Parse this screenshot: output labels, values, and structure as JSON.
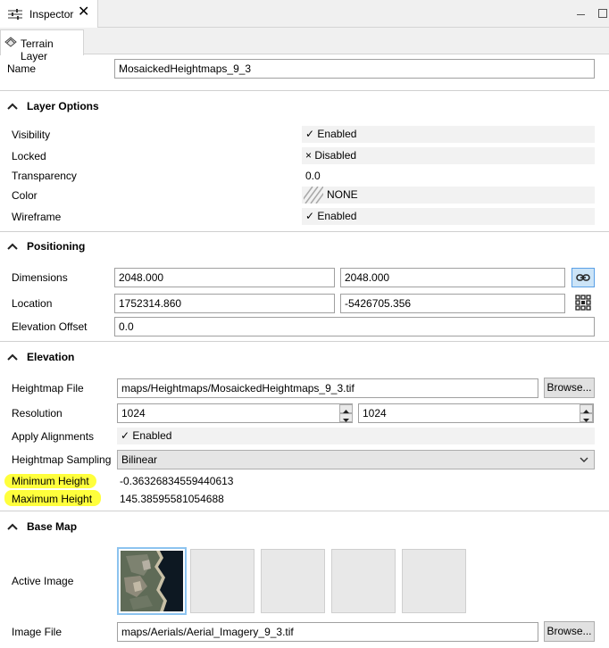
{
  "window": {
    "tab_title": "Inspector",
    "sub_tab": "Terrain Layer"
  },
  "name": {
    "label": "Name",
    "value": "MosaickedHeightmaps_9_3"
  },
  "layer_options": {
    "title": "Layer Options",
    "visibility": {
      "label": "Visibility",
      "value": "✓ Enabled"
    },
    "locked": {
      "label": "Locked",
      "value": "× Disabled"
    },
    "transparency": {
      "label": "Transparency",
      "value": "0.0"
    },
    "color": {
      "label": "Color",
      "value": "NONE"
    },
    "wireframe": {
      "label": "Wireframe",
      "value": "✓ Enabled"
    }
  },
  "positioning": {
    "title": "Positioning",
    "dimensions": {
      "label": "Dimensions",
      "x": "2048.000",
      "y": "2048.000"
    },
    "location": {
      "label": "Location",
      "x": "1752314.860",
      "y": "-5426705.356"
    },
    "elevation_offset": {
      "label": "Elevation Offset",
      "value": "0.0"
    }
  },
  "elevation": {
    "title": "Elevation",
    "heightmap_file": {
      "label": "Heightmap File",
      "value": "maps/Heightmaps/MosaickedHeightmaps_9_3.tif",
      "button": "Browse..."
    },
    "resolution": {
      "label": "Resolution",
      "x": "1024",
      "y": "1024"
    },
    "apply_alignments": {
      "label": "Apply Alignments",
      "value": "✓ Enabled"
    },
    "heightmap_sampling": {
      "label": "Heightmap Sampling",
      "value": "Bilinear"
    },
    "minimum_height": {
      "label": "Minimum Height",
      "value": "-0.36326834559440613"
    },
    "maximum_height": {
      "label": "Maximum Height",
      "value": "145.38595581054688"
    }
  },
  "base_map": {
    "title": "Base Map",
    "active_image": {
      "label": "Active Image"
    },
    "image_file": {
      "label": "Image File",
      "value": "maps/Aerials/Aerial_Imagery_9_3.tif",
      "button": "Browse..."
    }
  },
  "colors": {
    "highlight": "#ffff3c",
    "accent": "#cce4f7"
  }
}
